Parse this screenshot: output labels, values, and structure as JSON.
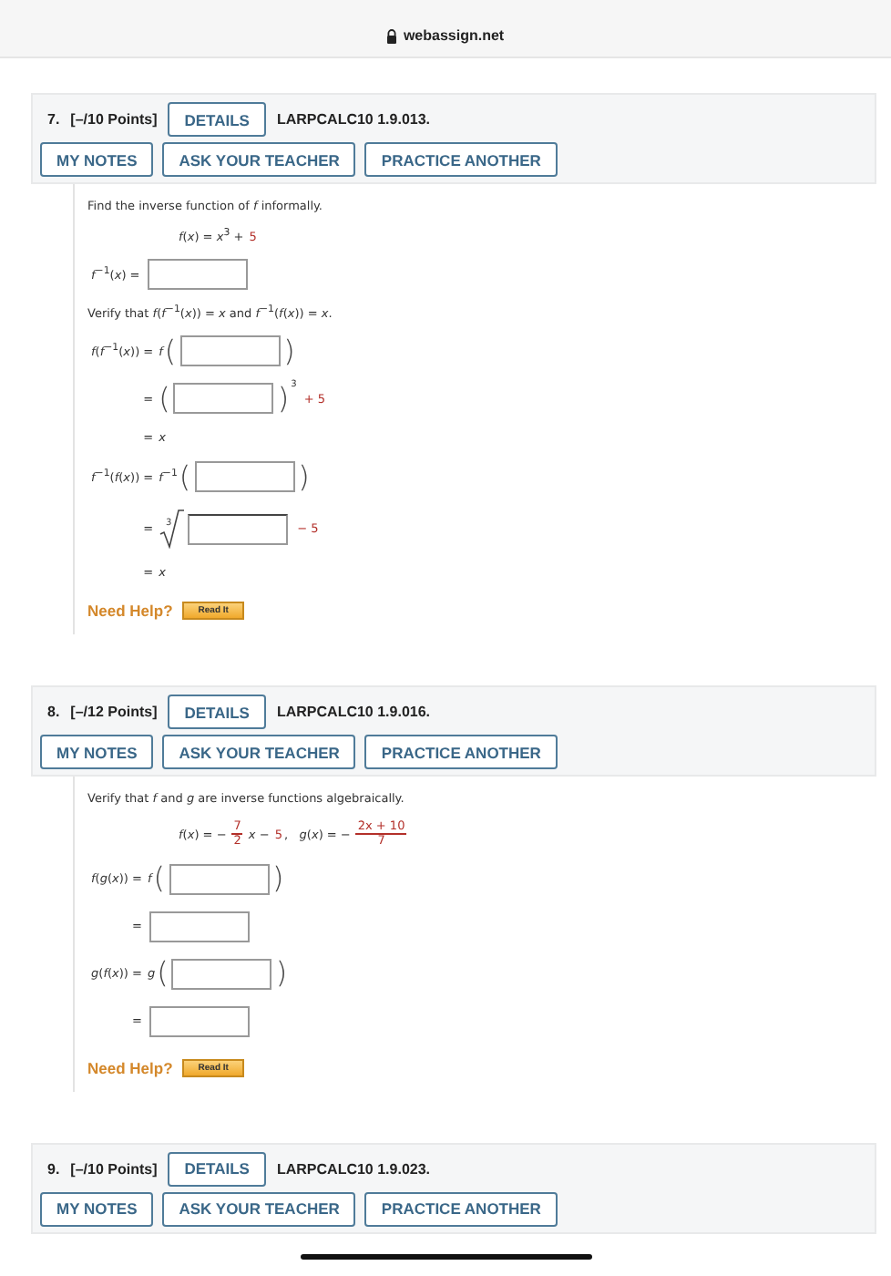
{
  "browser": {
    "url": "webassign.net"
  },
  "questions": [
    {
      "number": "7.",
      "points": "[–/10 Points]",
      "details": "DETAILS",
      "code": "LARPCALC10 1.9.013.",
      "buttons": [
        "MY NOTES",
        "ASK YOUR TEACHER",
        "PRACTICE ANOTHER"
      ],
      "body": [
        {
          "kind": "prompt",
          "text": "Find the inverse function of *f* informally."
        },
        {
          "kind": "given",
          "segments": [
            {
              "kind": "text",
              "text": "*f*(*x*) = *x*$^{3}$ + "
            },
            {
              "kind": "red",
              "text": "5"
            }
          ]
        },
        {
          "kind": "answers",
          "rows": [
            {
              "kind": "input",
              "lhs": "*f*$^{−1}$(*x*) ="
            }
          ]
        },
        {
          "kind": "prompt",
          "text": "Verify that *f*(*f*$^{−1}$(*x*)) = *x* and *f*$^{−1}$(*f*(*x*)) = *x*."
        },
        {
          "kind": "answers",
          "rows": [
            {
              "kind": "input",
              "lhs": "*f*(*f*$^{−1}$(*x*)) =",
              "prefix": "*f*",
              "open": "(",
              "close": ")"
            },
            {
              "kind": "input",
              "lhs": "=",
              "open": "(",
              "close": ")",
              "exponent": "3",
              "tail": "+ 5"
            },
            {
              "kind": "result",
              "lhs": "=",
              "result": "*x*"
            },
            {
              "kind": "input",
              "lhs": "*f*$^{−1}$(*f*(*x*)) =",
              "prefix": "*f*$^{−1}$",
              "open": "(",
              "close": ")"
            },
            {
              "kind": "input",
              "lhs": "=",
              "root_index": "3",
              "tail": "− 5"
            },
            {
              "kind": "result",
              "lhs": "=",
              "result": "*x*"
            }
          ]
        }
      ],
      "help": "Need Help?",
      "read": "Read It"
    },
    {
      "number": "8.",
      "points": "[–/12 Points]",
      "details": "DETAILS",
      "code": "LARPCALC10 1.9.016.",
      "buttons": [
        "MY NOTES",
        "ASK YOUR TEACHER",
        "PRACTICE ANOTHER"
      ],
      "body": [
        {
          "kind": "prompt",
          "text": "Verify that *f* and *g* are inverse functions algebraically."
        },
        {
          "kind": "given",
          "segments": [
            {
              "kind": "text",
              "text": "*f*(*x*) = −"
            },
            {
              "kind": "fraction",
              "num": "7",
              "den": "2"
            },
            {
              "kind": "text",
              "text": "*x* − "
            },
            {
              "kind": "red",
              "text": "5"
            },
            {
              "kind": "text",
              "text": ",   *g*(*x*) = −"
            },
            {
              "kind": "fraction",
              "num": "2x + 10",
              "den": "7"
            }
          ]
        },
        {
          "kind": "answers",
          "rows": [
            {
              "kind": "input",
              "lhs": "*f*(*g*(*x*)) =",
              "prefix": "*f*",
              "open": "(",
              "close": ")"
            },
            {
              "kind": "input",
              "lhs": "="
            },
            {
              "kind": "input",
              "lhs": "*g*(*f*(*x*)) =",
              "prefix": "*g*",
              "open": "(",
              "close": ")"
            },
            {
              "kind": "input",
              "lhs": "="
            }
          ]
        }
      ],
      "help": "Need Help?",
      "read": "Read It"
    },
    {
      "number": "9.",
      "points": "[–/10 Points]",
      "details": "DETAILS",
      "code": "LARPCALC10 1.9.023.",
      "buttons": [
        "MY NOTES",
        "ASK YOUR TEACHER",
        "PRACTICE ANOTHER"
      ]
    }
  ]
}
